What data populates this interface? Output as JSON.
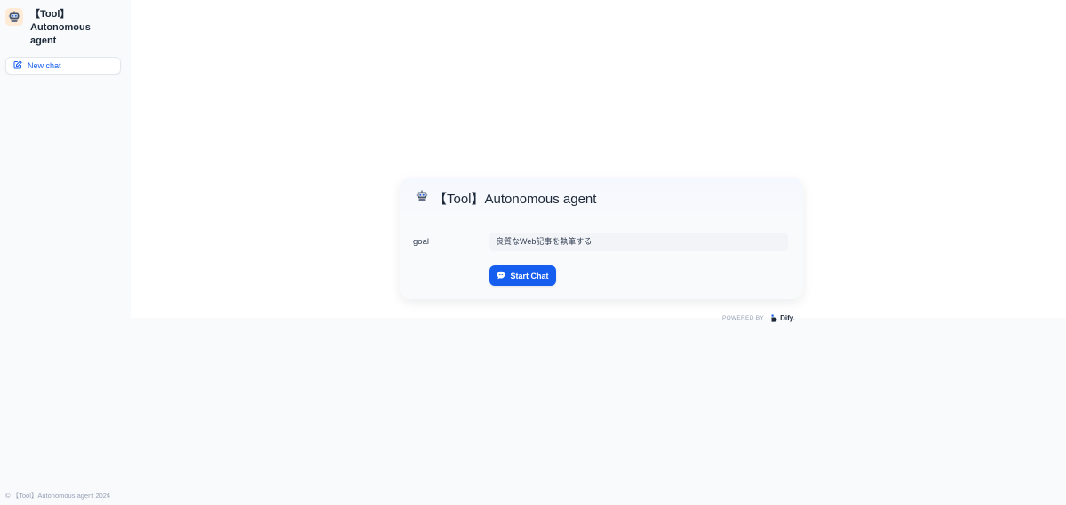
{
  "app": {
    "title": "【Tool】Autonomous agent",
    "icon": "robot-icon",
    "accent_color": "#155eef"
  },
  "sidebar": {
    "new_chat_label": "New chat",
    "copyright": "© 【Tool】Autonomous agent 2024"
  },
  "card": {
    "title": "【Tool】Autonomous agent",
    "fields": [
      {
        "label": "goal",
        "value": "良質なWeb記事を執筆する"
      }
    ],
    "start_button_label": "Start Chat"
  },
  "footer": {
    "powered_by": "POWERED BY",
    "brand": "Dify."
  }
}
